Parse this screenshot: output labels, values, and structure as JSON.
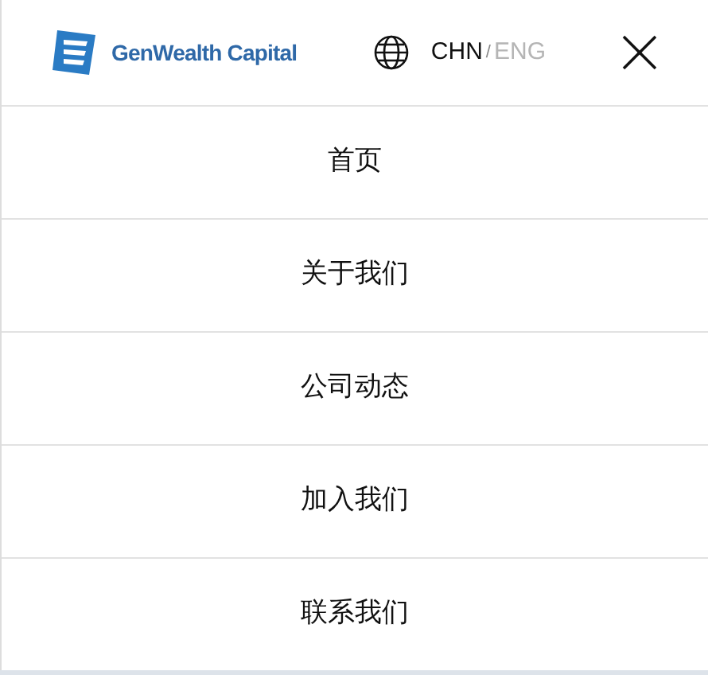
{
  "logo": {
    "text": "GenWealth Capital"
  },
  "languages": [
    {
      "label": "CHN",
      "selected": true
    },
    {
      "label": "ENG",
      "selected": false
    }
  ],
  "language_separator": "/",
  "menu": [
    {
      "label": "首页"
    },
    {
      "label": "关于我们"
    },
    {
      "label": "公司动态"
    },
    {
      "label": "加入我们"
    },
    {
      "label": "联系我们"
    }
  ]
}
